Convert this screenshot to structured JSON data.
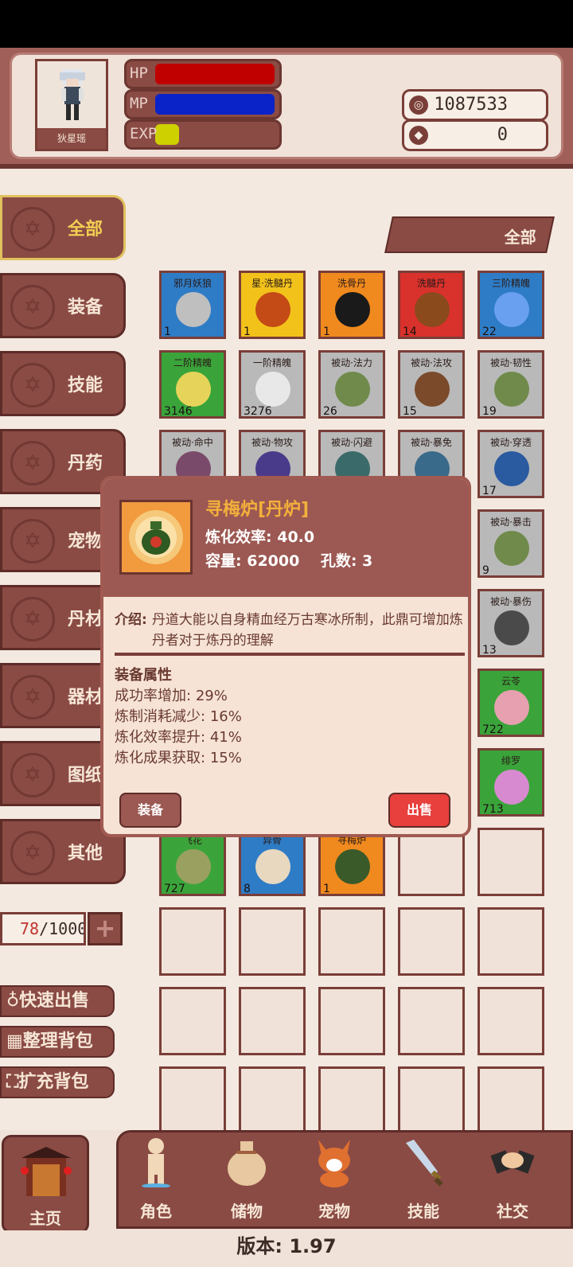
{
  "header": {
    "player_name": "狄星瑶",
    "bars": [
      {
        "label": "HP",
        "fill": 1.0,
        "color": "#c00000"
      },
      {
        "label": "MP",
        "fill": 1.0,
        "color": "#0a23c8"
      },
      {
        "label": "EXP",
        "fill": 0.2,
        "color": "#cfd000"
      }
    ],
    "currency": [
      {
        "icon": "coin-icon",
        "value": "1087533"
      },
      {
        "icon": "gem-icon",
        "value": "0"
      }
    ]
  },
  "sidebar": {
    "tabs": [
      {
        "label": "全部",
        "active": true
      },
      {
        "label": "装备"
      },
      {
        "label": "技能"
      },
      {
        "label": "丹药"
      },
      {
        "label": "宠物"
      },
      {
        "label": "丹材"
      },
      {
        "label": "器材"
      },
      {
        "label": "图纸"
      },
      {
        "label": "其他"
      }
    ],
    "capacity_used": "78",
    "capacity_total": "/1000",
    "actions": [
      "快速出售",
      "整理背包",
      "扩充背包"
    ]
  },
  "filter_label": "全部",
  "grid": {
    "rows": [
      [
        {
          "name": "邪月妖狼",
          "count": "1",
          "bg": "#2f7cc6",
          "art": "#bfbfbf"
        },
        {
          "name": "星·洗髓丹",
          "count": "1",
          "bg": "#f2c21b",
          "art": "#c44a16"
        },
        {
          "name": "洗骨丹",
          "count": "1",
          "bg": "#f08a1e",
          "art": "#1a1a1a"
        },
        {
          "name": "洗髓丹",
          "count": "14",
          "bg": "#d9312c",
          "art": "#8a4a1c"
        },
        {
          "name": "三阶精魄",
          "count": "22",
          "bg": "#2f7cc6",
          "art": "#6aa0f0"
        }
      ],
      [
        {
          "name": "二阶精魄",
          "count": "3146",
          "bg": "#3aa43a",
          "art": "#e6d45a"
        },
        {
          "name": "一阶精魄",
          "count": "3276",
          "bg": "#b9b9b9",
          "art": "#e8e8e8"
        },
        {
          "name": "被动·法力",
          "count": "26",
          "bg": "#b9b9b9",
          "art": "#6f8a4a"
        },
        {
          "name": "被动·法攻",
          "count": "15",
          "bg": "#b9b9b9",
          "art": "#7a4a2a"
        },
        {
          "name": "被动·韧性",
          "count": "19",
          "bg": "#b9b9b9",
          "art": "#6f8a4a"
        }
      ],
      [
        {
          "name": "被动·命中",
          "count": "",
          "bg": "#b9b9b9",
          "art": "#7a4a6a"
        },
        {
          "name": "被动·物攻",
          "count": "",
          "bg": "#b9b9b9",
          "art": "#4a3a8a"
        },
        {
          "name": "被动·闪避",
          "count": "",
          "bg": "#b9b9b9",
          "art": "#3a6a6a"
        },
        {
          "name": "被动·暴免",
          "count": "",
          "bg": "#b9b9b9",
          "art": "#3a6a8a"
        },
        {
          "name": "被动·穿透",
          "count": "17",
          "bg": "#b9b9b9",
          "art": "#2a5aa0"
        }
      ],
      [
        {
          "name": "",
          "count": "",
          "bg": "",
          "art": ""
        },
        {
          "name": "",
          "count": "",
          "bg": "",
          "art": ""
        },
        {
          "name": "",
          "count": "",
          "bg": "",
          "art": ""
        },
        {
          "name": "",
          "count": "",
          "bg": "",
          "art": ""
        },
        {
          "name": "被动·暴击",
          "count": "9",
          "bg": "#b9b9b9",
          "art": "#6f8a4a"
        }
      ],
      [
        {
          "name": "",
          "count": "",
          "bg": "",
          "art": ""
        },
        {
          "name": "",
          "count": "",
          "bg": "",
          "art": ""
        },
        {
          "name": "",
          "count": "",
          "bg": "",
          "art": ""
        },
        {
          "name": "",
          "count": "",
          "bg": "",
          "art": ""
        },
        {
          "name": "被动·暴伤",
          "count": "13",
          "bg": "#b9b9b9",
          "art": "#4a4a4a"
        }
      ],
      [
        {
          "name": "",
          "count": "",
          "bg": "",
          "art": ""
        },
        {
          "name": "",
          "count": "",
          "bg": "",
          "art": ""
        },
        {
          "name": "",
          "count": "",
          "bg": "",
          "art": ""
        },
        {
          "name": "",
          "count": "",
          "bg": "",
          "art": ""
        },
        {
          "name": "云苓",
          "count": "722",
          "bg": "#3aa43a",
          "art": "#e6a0b0"
        }
      ],
      [
        {
          "name": "",
          "count": "",
          "bg": "",
          "art": ""
        },
        {
          "name": "",
          "count": "",
          "bg": "",
          "art": ""
        },
        {
          "name": "",
          "count": "",
          "bg": "",
          "art": ""
        },
        {
          "name": "",
          "count": "",
          "bg": "",
          "art": ""
        },
        {
          "name": "绯罗",
          "count": "713",
          "bg": "#3aa43a",
          "art": "#d88ad0"
        }
      ],
      [
        {
          "name": "飞花",
          "count": "727",
          "bg": "#3aa43a",
          "art": "#9aa060"
        },
        {
          "name": "异骨",
          "count": "8",
          "bg": "#2f7cc6",
          "art": "#e8d8c0"
        },
        {
          "name": "寻梅炉",
          "count": "1",
          "bg": "#f08a1e",
          "art": "#3a5a2a"
        },
        {
          "name": "",
          "count": "",
          "bg": "",
          "art": ""
        },
        {
          "name": "",
          "count": "",
          "bg": "",
          "art": ""
        }
      ],
      [
        {
          "name": "",
          "count": "",
          "bg": "",
          "art": ""
        },
        {
          "name": "",
          "count": "",
          "bg": "",
          "art": ""
        },
        {
          "name": "",
          "count": "",
          "bg": "",
          "art": ""
        },
        {
          "name": "",
          "count": "",
          "bg": "",
          "art": ""
        },
        {
          "name": "",
          "count": "",
          "bg": "",
          "art": ""
        }
      ],
      [
        {
          "name": "",
          "count": "",
          "bg": "",
          "art": ""
        },
        {
          "name": "",
          "count": "",
          "bg": "",
          "art": ""
        },
        {
          "name": "",
          "count": "",
          "bg": "",
          "art": ""
        },
        {
          "name": "",
          "count": "",
          "bg": "",
          "art": ""
        },
        {
          "name": "",
          "count": "",
          "bg": "",
          "art": ""
        }
      ],
      [
        {
          "name": "",
          "count": "",
          "bg": "",
          "art": ""
        },
        {
          "name": "",
          "count": "",
          "bg": "",
          "art": ""
        },
        {
          "name": "",
          "count": "",
          "bg": "",
          "art": ""
        },
        {
          "name": "",
          "count": "",
          "bg": "",
          "art": ""
        },
        {
          "name": "",
          "count": "",
          "bg": "",
          "art": ""
        }
      ]
    ]
  },
  "popup": {
    "title": "寻梅炉[丹炉]",
    "line1_label": "炼化效率:",
    "line1_value": "40.0",
    "capacity_label": "容量:",
    "capacity_value": "62000",
    "holes_label": "孔数:",
    "holes_value": "3",
    "desc_label": "介绍:",
    "desc_text": "丹道大能以自身精血经万古寒冰所制，此鼎可增加炼丹者对于炼丹的理解",
    "attr_title": "装备属性",
    "attrs": [
      {
        "label": "成功率增加:",
        "value": "29%"
      },
      {
        "label": "炼制消耗减少:",
        "value": "16%"
      },
      {
        "label": "炼化效率提升:",
        "value": "41%"
      },
      {
        "label": "炼化成果获取:",
        "value": "15%"
      }
    ],
    "equip_button": "装备",
    "sell_button": "出售"
  },
  "bottom_nav": {
    "home": "主页",
    "items": [
      "角色",
      "储物",
      "宠物",
      "技能",
      "社交"
    ]
  },
  "version": "版本: 1.97"
}
